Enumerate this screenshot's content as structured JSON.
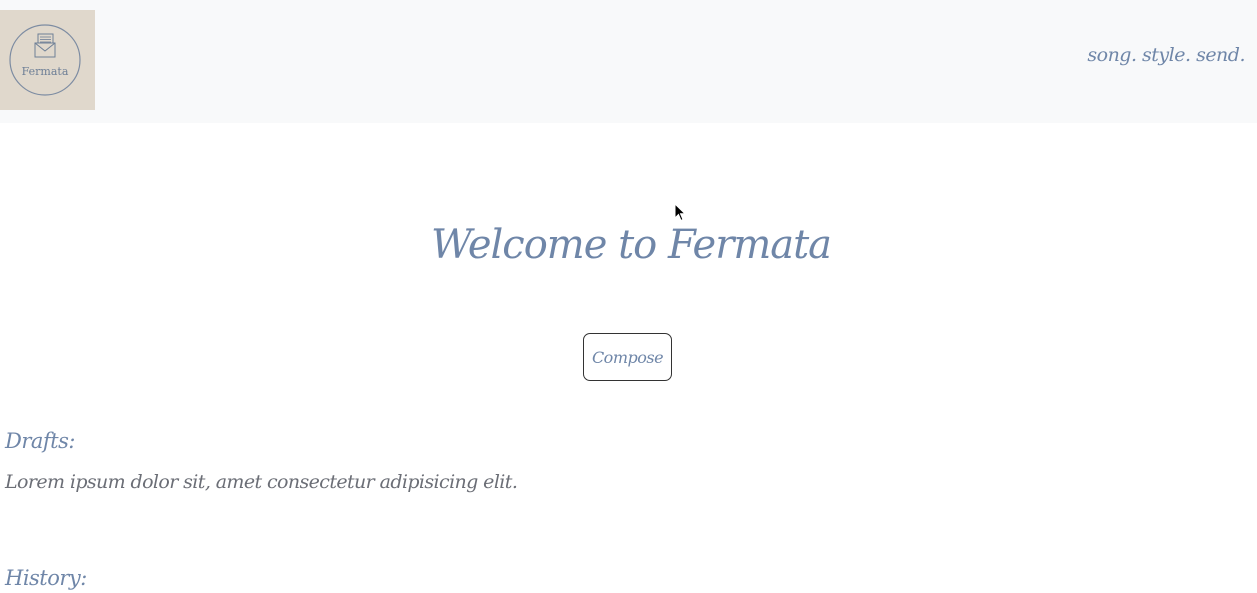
{
  "header": {
    "logo_text": "Fermata",
    "tagline": "song. style. send."
  },
  "main": {
    "welcome_title": "Welcome to Fermata",
    "compose_label": "Compose"
  },
  "drafts": {
    "heading": "Drafts:",
    "items": [
      {
        "text": "Lorem ipsum dolor sit, amet consectetur adipisicing elit."
      }
    ]
  },
  "history": {
    "heading": "History:"
  },
  "colors": {
    "accent": "#6f86a8",
    "header_bg": "#f8f9fa",
    "logo_bg": "#e0d8cc",
    "body_text": "#6b6e76"
  },
  "icons": {
    "logo": "envelope-with-music-sheet-icon",
    "cursor": "mouse-pointer-icon"
  }
}
